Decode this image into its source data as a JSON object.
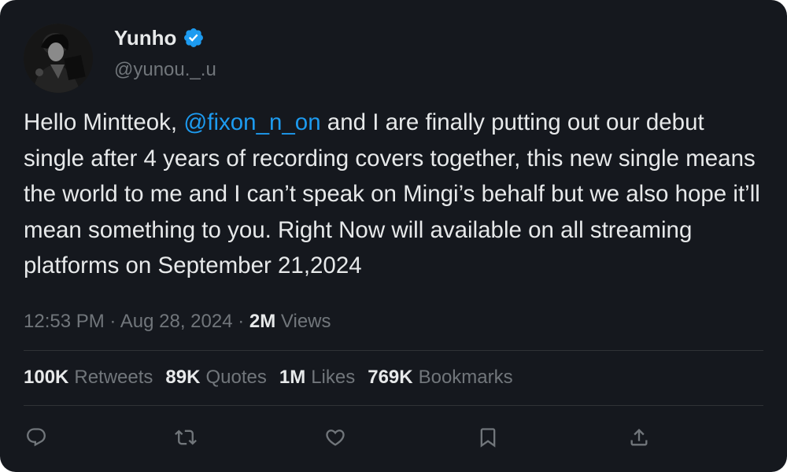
{
  "author": {
    "display_name": "Yunho",
    "handle": "@yunou._.u",
    "verified": true,
    "verified_color": "#1d9bf0"
  },
  "tweet": {
    "text_before_mention": "Hello Mintteok, ",
    "mention": "@fixon_n_on",
    "text_after_mention": " and I are finally putting out our debut single after 4 years of recording covers together, this new single means the world to me and I can’t speak on Mingi’s behalf but we also hope it’ll mean something to you. Right Now will available on all streaming platforms on September 21,2024"
  },
  "meta": {
    "time": "12:53 PM",
    "dot1": "·",
    "date": "Aug 28, 2024",
    "dot2": "·",
    "views_count": "2M",
    "views_label": "Views"
  },
  "stats": [
    {
      "count": "100K",
      "label": "Retweets"
    },
    {
      "count": "89K",
      "label": "Quotes"
    },
    {
      "count": "1M",
      "label": "Likes"
    },
    {
      "count": "769K",
      "label": "Bookmarks"
    }
  ],
  "actions": [
    {
      "icon": "reply-icon"
    },
    {
      "icon": "retweet-icon"
    },
    {
      "icon": "like-icon"
    },
    {
      "icon": "bookmark-icon"
    },
    {
      "icon": "share-icon"
    }
  ],
  "colors": {
    "background": "#15181e",
    "text_primary": "#e7e9ea",
    "text_secondary": "#71767b",
    "accent": "#1d9bf0",
    "divider": "#2f3336"
  }
}
